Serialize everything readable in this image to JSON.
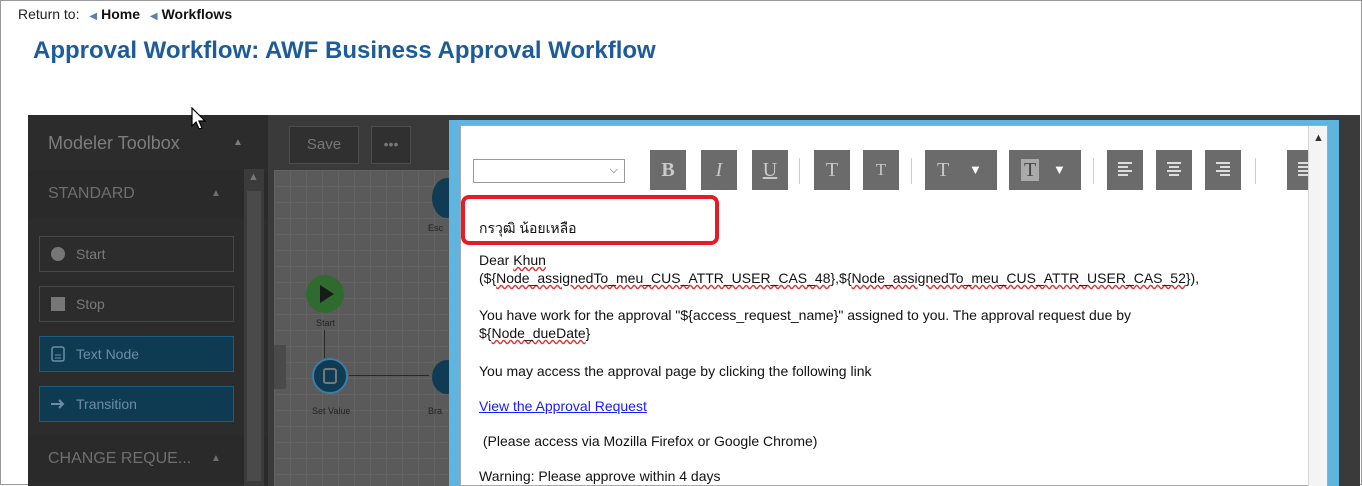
{
  "breadcrumb": {
    "prefix": "Return to:",
    "items": [
      "Home",
      "Workflows"
    ]
  },
  "page": {
    "title": "Approval Workflow: AWF Business Approval Workflow"
  },
  "toolbox": {
    "title": "Modeler Toolbox",
    "section_standard": "STANDARD",
    "items": [
      "Start",
      "Stop",
      "Text Node",
      "Transition"
    ],
    "section_change": "CHANGE REQUE..."
  },
  "modeler_toolbar": {
    "save": "Save",
    "more": "•••"
  },
  "canvas": {
    "labels": {
      "start": "Start",
      "set_value": "Set Value",
      "esc": "Esc",
      "bra": "Bra"
    }
  },
  "editor": {
    "toolbar": {
      "select_value": "",
      "buttons": [
        "B",
        "I",
        "U",
        "T",
        "T",
        "T",
        "T"
      ]
    },
    "content": {
      "thai_name": "กรวุฒิ น้อยเหลือ",
      "greeting_1": "Dear ",
      "greeting_khun": "Khun",
      "greeting_2": "(${",
      "node_1": "Node_assignedTo_meu_CUS_ATTR_USER_CAS_48",
      "greeting_3": "},${",
      "node_2": "Node_assignedTo_meu_CUS_ATTR_USER_CAS_52",
      "greeting_4": "}),",
      "work_1": "You have work for the approval \"${access_request_name}\" assigned to you. The approval request due by",
      "work_2a": "${",
      "work_2b": "Node_dueDate",
      "work_2c": "}",
      "access_line": "You may access the approval page by clicking the following link",
      "link": "View the Approval Request",
      "browser_note": " (Please access via Mozilla Firefox or Google Chrome)",
      "warning": "Warning: Please approve within 4 days"
    }
  },
  "colors": {
    "title": "#1d5c99",
    "highlight": "#e51c23",
    "link": "#1a1aff",
    "editor_border": "#5fb4e0"
  }
}
